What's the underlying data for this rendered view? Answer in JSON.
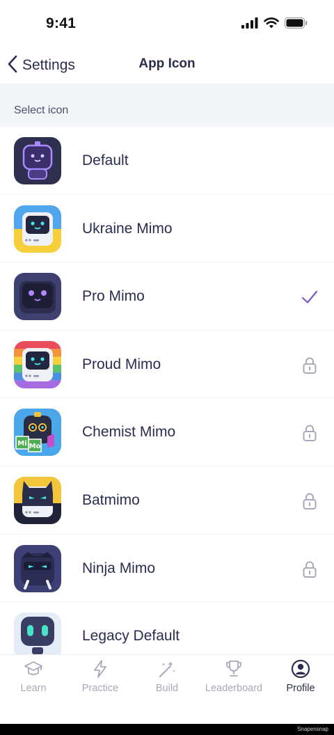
{
  "status_bar": {
    "time": "9:41"
  },
  "nav": {
    "back_label": "Settings",
    "title": "App Icon"
  },
  "section": {
    "label": "Select icon"
  },
  "icons": [
    {
      "label": "Default",
      "state": "none"
    },
    {
      "label": "Ukraine Mimo",
      "state": "none"
    },
    {
      "label": "Pro Mimo",
      "state": "selected"
    },
    {
      "label": "Proud Mimo",
      "state": "locked"
    },
    {
      "label": "Chemist Mimo",
      "state": "locked"
    },
    {
      "label": "Batmimo",
      "state": "locked"
    },
    {
      "label": "Ninja Mimo",
      "state": "locked"
    },
    {
      "label": "Legacy Default",
      "state": "none"
    }
  ],
  "chemist_badge": {
    "left": "Mi",
    "right": "Mo"
  },
  "tabs": [
    {
      "label": "Learn",
      "icon": "graduation-cap-icon",
      "active": false
    },
    {
      "label": "Practice",
      "icon": "lightning-icon",
      "active": false
    },
    {
      "label": "Build",
      "icon": "magic-wand-icon",
      "active": false
    },
    {
      "label": "Leaderboard",
      "icon": "trophy-icon",
      "active": false
    },
    {
      "label": "Profile",
      "icon": "profile-icon",
      "active": true
    }
  ],
  "watermark": "Snapensnap",
  "colors": {
    "accent": "#7a55c6",
    "text": "#2b2d50",
    "muted": "#a7a9bb",
    "section_bg": "#f4f5f8"
  }
}
